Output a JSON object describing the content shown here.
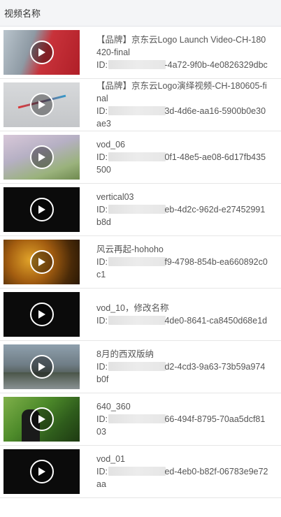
{
  "header": {
    "title": "视频名称"
  },
  "videos": [
    {
      "title": "【品牌】京东云Logo Launch Video-CH-180420-final",
      "id_prefix": "ID: ",
      "id_suffix": "-4a72-9f0b-4e0826329dbc"
    },
    {
      "title": "【品牌】京东云Logo演绎视频-CH-180605-final",
      "id_prefix": "ID: ",
      "id_suffix": "3d-4d6e-aa16-5900b0e30ae3"
    },
    {
      "title": "vod_06",
      "id_prefix": "ID: ",
      "id_suffix": "0f1-48e5-ae08-6d17fb435500"
    },
    {
      "title": "vertical03",
      "id_prefix": "ID: ",
      "id_suffix": "eb-4d2c-962d-e27452991b8d"
    },
    {
      "title": "风云再起-hohoho",
      "id_prefix": "ID: ",
      "id_suffix": "f9-4798-854b-ea660892c0c1"
    },
    {
      "title": "vod_10，修改名称",
      "id_prefix": "ID: ",
      "id_suffix": "4de0-8641-ca8450d68e1d"
    },
    {
      "title": "8月的西双版纳",
      "id_prefix": "ID: ",
      "id_suffix": "d2-4cd3-9a63-73b59a974b0f"
    },
    {
      "title": "640_360",
      "id_prefix": "ID: ",
      "id_suffix": "66-494f-8795-70aa5dcf8103"
    },
    {
      "title": "vod_01",
      "id_prefix": "ID: ",
      "id_suffix": "ed-4eb0-b82f-06783e9e72aa"
    }
  ],
  "icons": {
    "play": "play-circle-icon"
  }
}
